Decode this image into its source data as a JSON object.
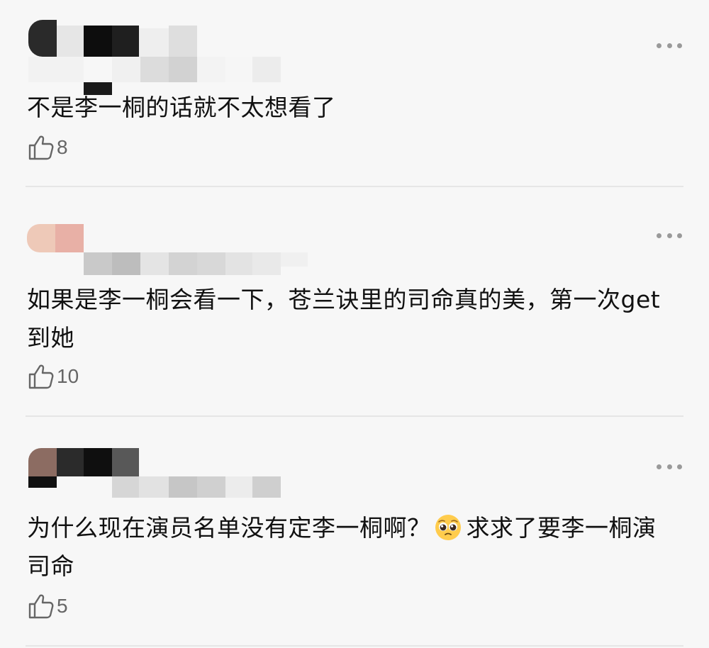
{
  "comments": [
    {
      "text": "不是李一桐的话就不太想看了",
      "likes": "8"
    },
    {
      "text": "如果是李一桐会看一下，苍兰诀里的司命真的美，第一次get到她",
      "likes": "10"
    },
    {
      "text_before_emoji": "为什么现在演员名单没有定李一桐啊？",
      "emoji": "pleading-face",
      "text_after_emoji": "求求了要李一桐演司命",
      "likes": "5"
    }
  ],
  "colors": {
    "background": "#f7f7f7",
    "text": "#111111",
    "secondary": "#666666",
    "divider": "#e6e6e6"
  }
}
